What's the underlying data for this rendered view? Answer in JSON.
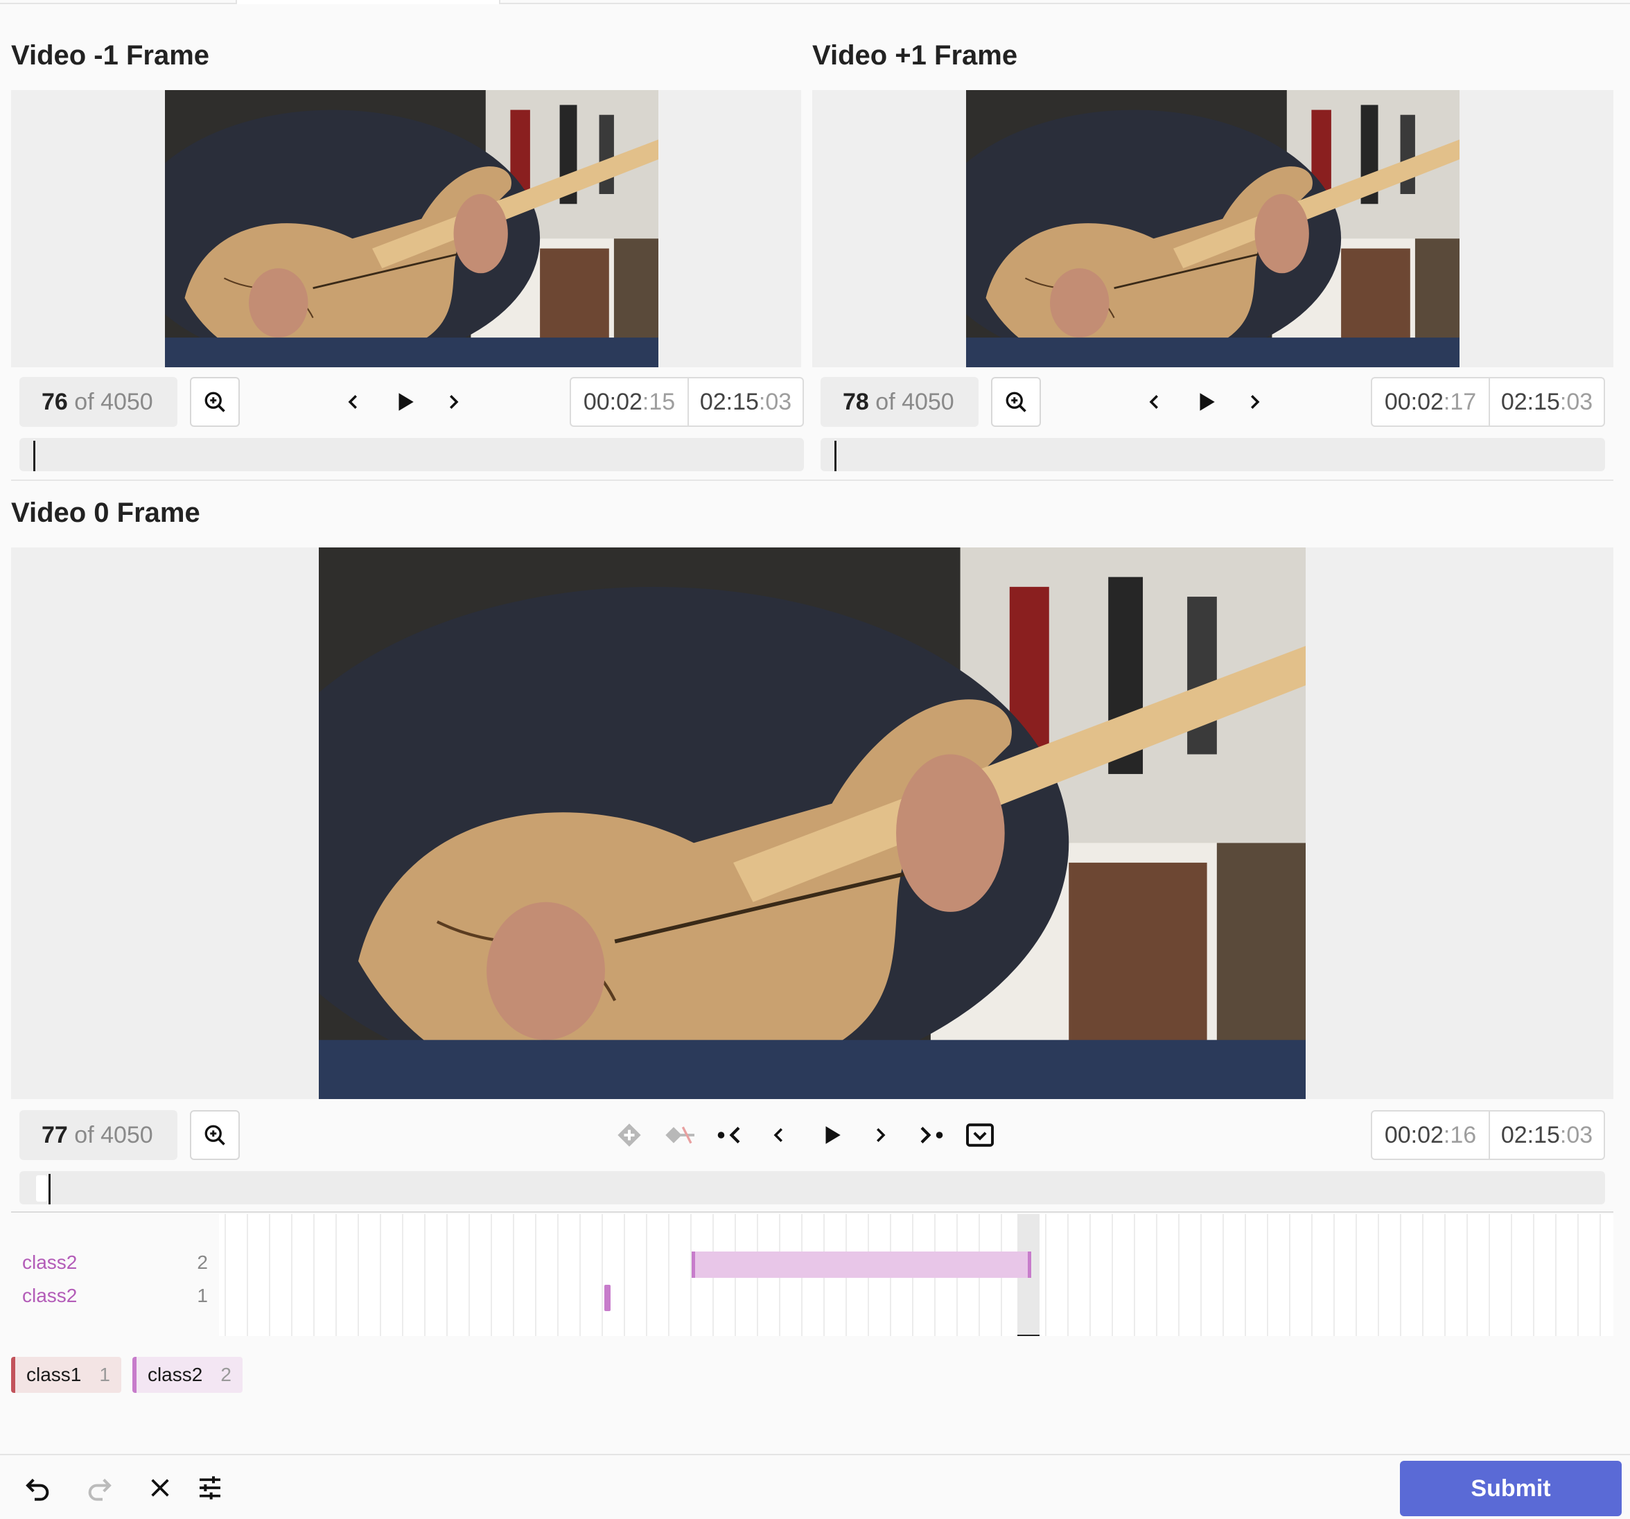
{
  "panels": {
    "prev": {
      "title": "Video -1 Frame",
      "frame_number": "76",
      "frame_of": "of 4050",
      "time_current_main": "00:02",
      "time_current_frac": ":15",
      "time_total_main": "02:15",
      "time_total_frac": ":03"
    },
    "next": {
      "title": "Video +1 Frame",
      "frame_number": "78",
      "frame_of": "of 4050",
      "time_current_main": "00:02",
      "time_current_frac": ":17",
      "time_total_main": "02:15",
      "time_total_frac": ":03"
    },
    "current": {
      "title": "Video 0 Frame",
      "frame_number": "77",
      "frame_of": "of 4050",
      "time_current_main": "00:02",
      "time_current_frac": ":16",
      "time_total_main": "02:15",
      "time_total_frac": ":03"
    }
  },
  "timeline": {
    "tracks": [
      {
        "name": "class2",
        "count": "2"
      },
      {
        "name": "class2",
        "count": "1"
      }
    ]
  },
  "labels": [
    {
      "name": "class1",
      "count": "1",
      "color": "#c2535b"
    },
    {
      "name": "class2",
      "count": "2",
      "color": "#c77ccb"
    }
  ],
  "footer": {
    "submit_label": "Submit"
  },
  "colors": {
    "accent": "#5a6ad6",
    "class2": "#c77ccb",
    "class1": "#c2535b"
  },
  "icons": [
    "zoom-in-icon",
    "chevron-left-icon",
    "play-icon",
    "chevron-right-icon",
    "add-keyframe-icon",
    "delete-keyframe-icon",
    "previous-keyframe-icon",
    "next-keyframe-icon",
    "collapse-icon",
    "undo-icon",
    "redo-icon",
    "close-icon",
    "settings-sliders-icon"
  ]
}
